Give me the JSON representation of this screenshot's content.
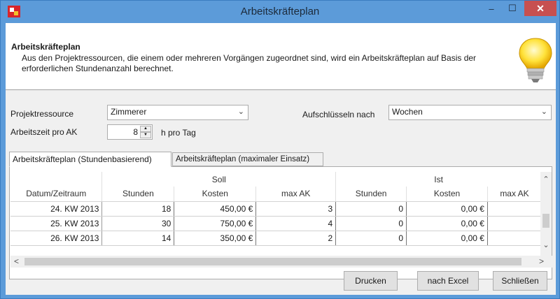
{
  "window": {
    "title": "Arbeitskräfteplan",
    "minimize": "–",
    "maximize": "☐",
    "close": "✕"
  },
  "header": {
    "title": "Arbeitskräfteplan",
    "description": "Aus den Projektressourcen, die einem oder mehreren Vorgängen zugeordnet sind, wird ein Arbeitskräfteplan auf Basis der erforderlichen Stundenanzahl berechnet.",
    "icon": "lightbulb-icon"
  },
  "form": {
    "resource_label": "Projektressource",
    "resource_value": "Zimmerer",
    "breakdown_label": "Aufschlüsseln nach",
    "breakdown_value": "Wochen",
    "worktime_label": "Arbeitszeit pro AK",
    "worktime_value": "8",
    "worktime_unit": "h pro Tag"
  },
  "tabs": [
    {
      "label": "Arbeitskräfteplan (Stundenbasierend)",
      "active": true
    },
    {
      "label": "Arbeitskräfteplan (maximaler Einsatz)",
      "active": false
    }
  ],
  "table": {
    "group_headers": {
      "soll": "Soll",
      "ist": "Ist"
    },
    "columns": [
      "Datum/Zeitraum",
      "Stunden",
      "Kosten",
      "max AK",
      "Stunden",
      "Kosten",
      "max AK"
    ],
    "rows": [
      [
        "24. KW 2013",
        "18",
        "450,00 €",
        "3",
        "0",
        "0,00 €",
        ""
      ],
      [
        "25. KW 2013",
        "30",
        "750,00 €",
        "4",
        "0",
        "0,00 €",
        ""
      ],
      [
        "26. KW 2013",
        "14",
        "350,00 €",
        "2",
        "0",
        "0,00 €",
        ""
      ]
    ]
  },
  "buttons": {
    "print": "Drucken",
    "excel": "nach Excel",
    "close": "Schließen"
  }
}
